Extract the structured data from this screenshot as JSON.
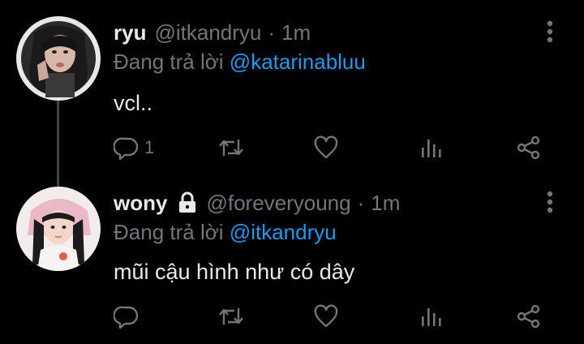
{
  "tweets": [
    {
      "display_name": "ryu",
      "handle": "@itkandryu",
      "separator": "·",
      "time": "1m",
      "reply_prefix": "Đang trả lời",
      "reply_to": "@katarinabluu",
      "text": "vcl..",
      "reply_count": "1",
      "protected": false,
      "icons": [
        "avatar",
        "more-vertical-icon",
        "reply-icon",
        "retweet-icon",
        "like-icon",
        "views-icon",
        "share-icon"
      ]
    },
    {
      "display_name": "wony",
      "handle": "@foreveryoung",
      "separator": "·",
      "time": "1m",
      "reply_prefix": "Đang trả lời",
      "reply_to": "@itkandryu",
      "text": "mũi cậu hình như có dây",
      "reply_count": "",
      "protected": true,
      "icons": [
        "avatar",
        "lock-icon",
        "more-vertical-icon",
        "reply-icon",
        "retweet-icon",
        "like-icon",
        "views-icon",
        "share-icon"
      ]
    }
  ],
  "colors": {
    "background": "#000000",
    "text_primary": "#e7e9ea",
    "text_secondary": "#71767b",
    "accent": "#1d9bf0",
    "thread_line": "#3f4449"
  }
}
